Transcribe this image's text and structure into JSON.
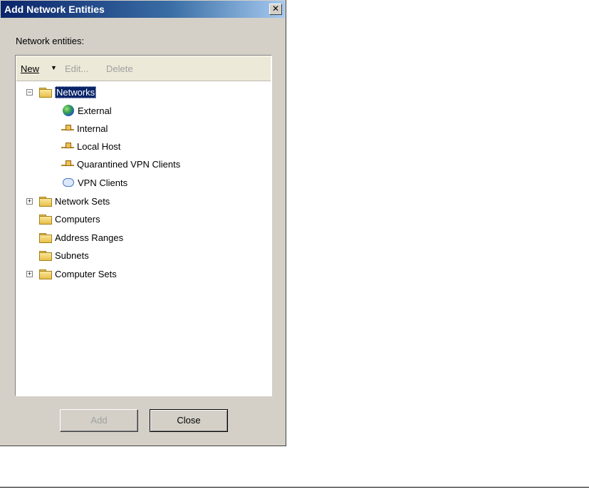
{
  "dialog": {
    "title": "Add Network Entities",
    "close_glyph": "✕",
    "label": "Network entities:"
  },
  "toolbar": {
    "new_label": "New",
    "new_arrow": "▼",
    "edit_label": "Edit...",
    "delete_label": "Delete"
  },
  "tree": {
    "networks": {
      "label": "Networks",
      "expander": "−",
      "children": [
        {
          "label": "External",
          "icon": "globe-icon"
        },
        {
          "label": "Internal",
          "icon": "network-icon"
        },
        {
          "label": "Local Host",
          "icon": "network-icon"
        },
        {
          "label": "Quarantined VPN Clients",
          "icon": "network-icon"
        },
        {
          "label": "VPN Clients",
          "icon": "vpn-cloud-icon"
        }
      ]
    },
    "network_sets": {
      "label": "Network Sets",
      "expander": "+"
    },
    "computers": {
      "label": "Computers"
    },
    "address_ranges": {
      "label": "Address Ranges"
    },
    "subnets": {
      "label": "Subnets"
    },
    "computer_sets": {
      "label": "Computer Sets",
      "expander": "+"
    }
  },
  "buttons": {
    "add_label": "Add",
    "close_label": "Close"
  },
  "colors": {
    "dialog_bg": "#d4d0c8",
    "titlebar": "#0a246a",
    "selection": "#0a246a",
    "toolbar_bg": "#ece9d8"
  }
}
